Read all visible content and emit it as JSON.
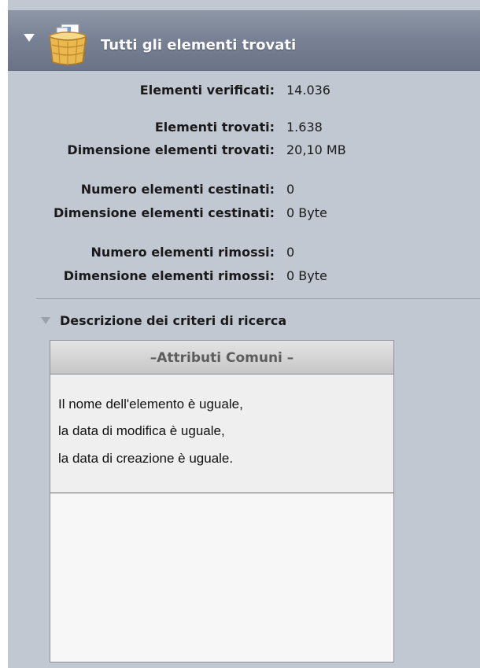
{
  "header": {
    "title": "Tutti gli elementi trovati",
    "icon": "basket-icon"
  },
  "stats": [
    {
      "label": "Elementi verificati:",
      "value": "14.036"
    },
    {
      "label": "Elementi trovati:",
      "value": "1.638"
    },
    {
      "label": "Dimensione elementi trovati:",
      "value": "20,10 MB"
    },
    {
      "label": "Numero elementi cestinati:",
      "value": "0"
    },
    {
      "label": "Dimensione elementi cestinati:",
      "value": "0 Byte"
    },
    {
      "label": "Numero elementi rimossi:",
      "value": "0"
    },
    {
      "label": "Dimensione elementi rimossi:",
      "value": "0 Byte"
    }
  ],
  "criteria": {
    "title": "Descrizione dei criteri di ricerca",
    "box_header": "–Attributi Comuni –",
    "lines": [
      "Il nome dell'elemento è uguale,",
      "la data di modifica è uguale,",
      "la data di creazione è uguale."
    ]
  },
  "colors": {
    "panel_bg": "#c2c8d2",
    "header_bg": "#778193"
  }
}
